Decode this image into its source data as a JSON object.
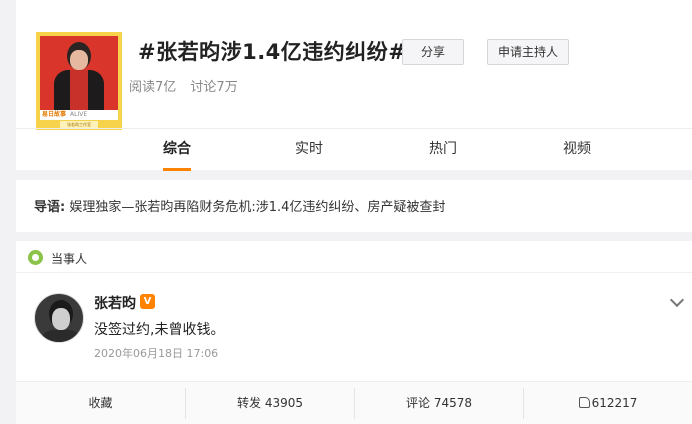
{
  "topic": {
    "title": "#张若昀涉1.4亿违约纠纷#",
    "reads": "阅读7亿",
    "discussions": "讨论7万",
    "share_label": "分享",
    "host_label": "申请主持人",
    "cover_tag": "易日故事",
    "cover_tag2": "ALIVE",
    "cover_foot": "张若昀工作室"
  },
  "tabs": [
    {
      "label": "综合",
      "active": true
    },
    {
      "label": "实时",
      "active": false
    },
    {
      "label": "热门",
      "active": false
    },
    {
      "label": "视频",
      "active": false
    }
  ],
  "summary": {
    "lead": "导语:",
    "text": " 娱理独家—张若昀再陷财务危机:涉1.4亿违约纠纷、房产疑被查封"
  },
  "post": {
    "party_label": "当事人",
    "user_name": "张若昀",
    "verified_badge": "V",
    "text": "没签过约,未曾收钱。",
    "time": "2020年06月18日 17:06",
    "actions": {
      "favorite": "收藏",
      "repost": "转发 43905",
      "comment": "评论 74578",
      "like_count": "612217"
    }
  },
  "colors": {
    "accent": "#ff8200",
    "party_icon": "#8bc34a"
  }
}
